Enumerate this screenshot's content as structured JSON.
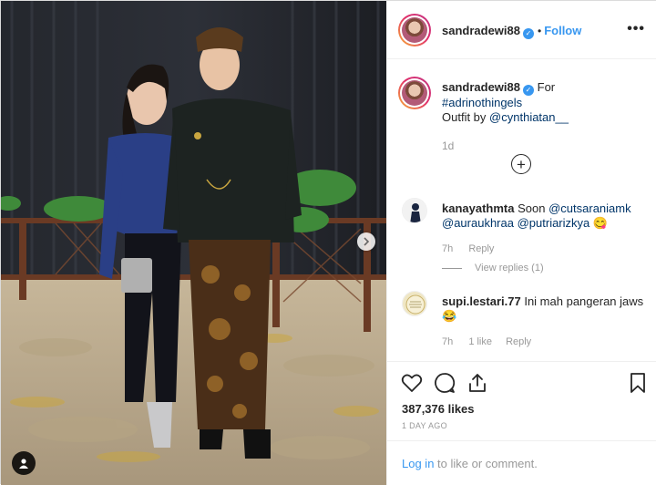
{
  "post": {
    "username": "sandradewi88",
    "follow_separator": "•",
    "follow_label": "Follow",
    "more_label": "•••"
  },
  "caption": {
    "username": "sandradewi88",
    "text_for": "For",
    "hashtag": "#adrinothingels",
    "outfit_prefix": "Outfit by",
    "mention": "@cynthiatan__",
    "time": "1d"
  },
  "load_more_label": "+",
  "comments": [
    {
      "username": "kanayathmta",
      "text": "Soon",
      "mentions": [
        "@cutsaraniamk",
        "@auraukhraa",
        "@putriarizkya"
      ],
      "emoji": "😋",
      "time": "7h",
      "reply_label": "Reply",
      "view_replies": "View replies (1)"
    },
    {
      "username": "supi.lestari.77",
      "text": "Ini mah pangeran jaws",
      "emoji": "😂",
      "time": "7h",
      "likes": "1 like",
      "reply_label": "Reply"
    }
  ],
  "actions": {
    "icons": [
      "heart-icon",
      "comment-icon",
      "share-icon",
      "bookmark-icon"
    ],
    "likes": "387,376 likes",
    "date": "1 DAY AGO"
  },
  "footer": {
    "login_label": "Log in",
    "login_suffix": "to like or comment."
  },
  "colors": {
    "link_blue": "#3897f0",
    "mention_navy": "#003569",
    "muted": "#999999",
    "border": "#efefef"
  }
}
